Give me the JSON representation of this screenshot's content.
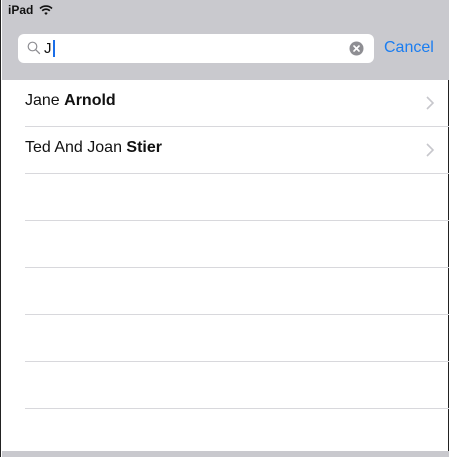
{
  "status_bar": {
    "carrier": "iPad",
    "wifi_icon": "wifi-icon"
  },
  "search": {
    "value": "J",
    "search_icon": "search-icon",
    "clear_icon": "clear-circle-icon",
    "cancel_label": "Cancel"
  },
  "results": [
    {
      "first": "Jane ",
      "last": "Arnold",
      "chevron_icon": "chevron-right-icon"
    },
    {
      "first": "Ted And Joan ",
      "last": "Stier",
      "chevron_icon": "chevron-right-icon"
    }
  ],
  "colors": {
    "accent": "#1a7df1",
    "header_bg": "#c9c9ce",
    "separator": "#d8d8dc"
  }
}
